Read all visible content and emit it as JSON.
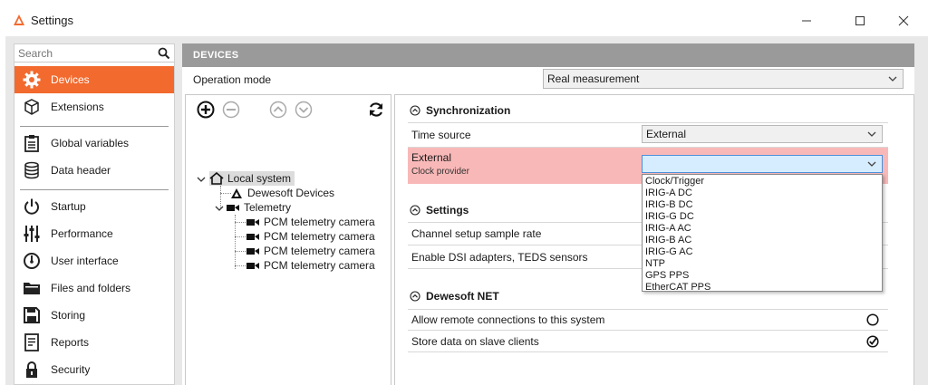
{
  "window": {
    "title": "Settings",
    "minimize_icon": "minimize-icon",
    "maximize_icon": "maximize-icon",
    "close_icon": "close-icon"
  },
  "sidebar": {
    "search": {
      "placeholder": "Search",
      "value": ""
    },
    "groups": [
      [
        {
          "label": "Devices",
          "icon": "gear-icon",
          "active": true
        },
        {
          "label": "Extensions",
          "icon": "cube-icon"
        }
      ],
      [
        {
          "label": "Global variables",
          "icon": "clipboard-icon"
        },
        {
          "label": "Data header",
          "icon": "database-icon"
        }
      ],
      [
        {
          "label": "Startup",
          "icon": "power-icon"
        },
        {
          "label": "Performance",
          "icon": "sliders-icon"
        },
        {
          "label": "User interface",
          "icon": "gauge-icon"
        },
        {
          "label": "Files and folders",
          "icon": "folder-icon"
        },
        {
          "label": "Storing",
          "icon": "save-icon"
        },
        {
          "label": "Reports",
          "icon": "report-icon"
        },
        {
          "label": "Security",
          "icon": "lock-icon"
        }
      ]
    ],
    "active_color": "#f26a2e"
  },
  "main": {
    "header": "DEVICES",
    "operation_mode": {
      "label": "Operation mode",
      "value": "Real measurement"
    },
    "tree": {
      "toolbar": [
        "add-icon",
        "remove-icon",
        "move-up-icon",
        "move-down-icon",
        "refresh-icon"
      ],
      "local_system": "Local system",
      "dewesoft_devices": "Dewesoft Devices",
      "telemetry": "Telemetry",
      "cameras": [
        "PCM telemetry camera",
        "PCM telemetry camera",
        "PCM telemetry camera",
        "PCM telemetry camera"
      ]
    },
    "synchronization": {
      "title": "Synchronization",
      "time_source": {
        "label": "Time source",
        "value": "External"
      },
      "external": {
        "label": "External",
        "sublabel": "Clock provider",
        "value": ""
      },
      "options": [
        "Clock/Trigger",
        "IRIG-A DC",
        "IRIG-B DC",
        "IRIG-G DC",
        "IRIG-A AC",
        "IRIG-B AC",
        "IRIG-G AC",
        "NTP",
        "GPS PPS",
        "EtherCAT PPS"
      ],
      "highlight_color": "#f9b8b8"
    },
    "settings": {
      "title": "Settings",
      "rows": [
        "Channel setup sample rate",
        "Enable DSI adapters, TEDS sensors"
      ]
    },
    "net": {
      "title": "Dewesoft NET",
      "rows": [
        {
          "label": "Allow remote connections to this system",
          "checked": false
        },
        {
          "label": "Store data on slave clients",
          "checked": true
        }
      ]
    }
  }
}
